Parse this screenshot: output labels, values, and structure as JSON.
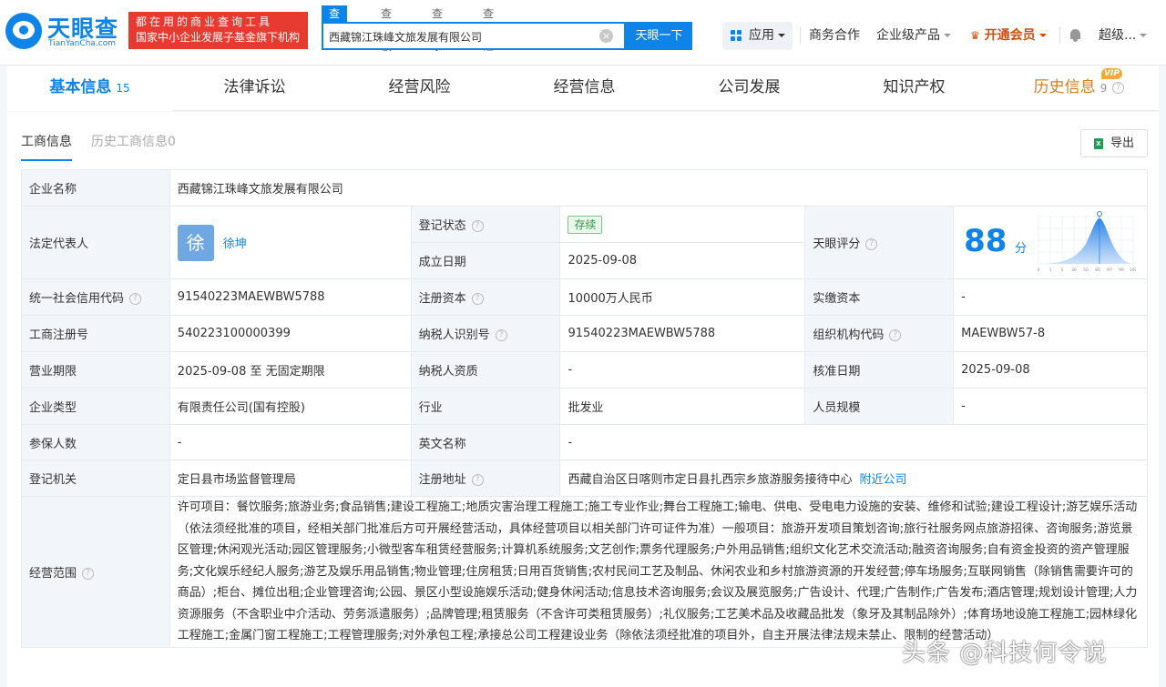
{
  "header": {
    "logo_name": "天眼查",
    "logo_domain": "TianYanCha.com",
    "slogan_line1": "都在用的商业查询工具",
    "slogan_line2": "国家中小企业发展子基金旗下机构",
    "search_tabs": [
      "查公司",
      "查老板",
      "查关系",
      "查风险"
    ],
    "search_value": "西藏锦江珠峰文旅发展有限公司",
    "search_button": "天眼一下",
    "apps_label": "应用",
    "nav": [
      "商务合作",
      "企业级产品",
      "开通会员",
      "超级..."
    ]
  },
  "main_tabs": [
    {
      "label": "基本信息",
      "count": "15"
    },
    {
      "label": "法律诉讼"
    },
    {
      "label": "经营风险"
    },
    {
      "label": "经营信息"
    },
    {
      "label": "公司发展"
    },
    {
      "label": "知识产权"
    },
    {
      "label": "历史信息",
      "count": "9",
      "badge": "VIP"
    }
  ],
  "sub_tabs": {
    "active": "工商信息",
    "inactive": "历史工商信息0"
  },
  "export_label": "导出",
  "excel_glyph": "X",
  "info": {
    "company_name_label": "企业名称",
    "company_name": "西藏锦江珠峰文旅发展有限公司",
    "legal_rep_label": "法定代表人",
    "legal_rep_avatar": "徐",
    "legal_rep_name": "徐坤",
    "reg_status_label": "登记状态",
    "reg_status": "存续",
    "found_date_label": "成立日期",
    "found_date": "2025-09-08",
    "score_label": "天眼评分",
    "score": "88",
    "score_unit": "分",
    "score_ticks": [
      "0",
      "1",
      "5",
      "30",
      "50",
      "85",
      "97",
      "99",
      "100"
    ],
    "credit_code_label": "统一社会信用代码",
    "credit_code": "91540223MAEWBW5788",
    "reg_capital_label": "注册资本",
    "reg_capital": "10000万人民币",
    "paid_capital_label": "实缴资本",
    "paid_capital": "-",
    "biz_reg_no_label": "工商注册号",
    "biz_reg_no": "540223100000399",
    "taxpayer_id_label": "纳税人识别号",
    "taxpayer_id": "91540223MAEWBW5788",
    "org_code_label": "组织机构代码",
    "org_code": "MAEWBW57-8",
    "term_label": "营业期限",
    "term": "2025-09-08 至 无固定期限",
    "taxpayer_qual_label": "纳税人资质",
    "taxpayer_qual": "-",
    "approve_date_label": "核准日期",
    "approve_date": "2025-09-08",
    "type_label": "企业类型",
    "type": "有限责任公司(国有控股)",
    "industry_label": "行业",
    "industry": "批发业",
    "staff_label": "人员规模",
    "staff": "-",
    "insured_label": "参保人数",
    "insured": "-",
    "english_name_label": "英文名称",
    "english_name": "-",
    "authority_label": "登记机关",
    "authority": "定日县市场监督管理局",
    "address_label": "注册地址",
    "address": "西藏自治区日喀则市定日县扎西宗乡旅游服务接待中心",
    "nearby_link": "附近公司",
    "scope_label": "经营范围",
    "scope": "许可项目：餐饮服务;旅游业务;食品销售;建设工程施工;地质灾害治理工程施工;施工专业作业;舞台工程施工;输电、供电、受电电力设施的安装、维修和试验;建设工程设计;游艺娱乐活动（依法须经批准的项目，经相关部门批准后方可开展经营活动，具体经营项目以相关部门许可证件为准）一般项目：旅游开发项目策划咨询;旅行社服务网点旅游招徕、咨询服务;游览景区管理;休闲观光活动;园区管理服务;小微型客车租赁经营服务;计算机系统服务;文艺创作;票务代理服务;户外用品销售;组织文化艺术交流活动;融资咨询服务;自有资金投资的资产管理服务;文化娱乐经纪人服务;游艺及娱乐用品销售;物业管理;住房租赁;日用百货销售;农村民间工艺及制品、休闲农业和乡村旅游资源的开发经营;停车场服务;互联网销售（除销售需要许可的商品）;柜台、摊位出租;企业管理咨询;公园、景区小型设施娱乐活动;健身休闲活动;信息技术咨询服务;会议及展览服务;广告设计、代理;广告制作;广告发布;酒店管理;规划设计管理;人力资源服务（不含职业中介活动、劳务派遣服务）;品牌管理;租赁服务（不含许可类租赁服务）;礼仪服务;工艺美术品及收藏品批发（象牙及其制品除外）;体育场地设施工程施工;园林绿化工程施工;金属门窗工程施工;工程管理服务;对外承包工程;承接总公司工程建设业务（除依法须经批准的项目外，自主开展法律法规未禁止、限制的经营活动）"
  },
  "watermark": "头条 @科技何令说"
}
